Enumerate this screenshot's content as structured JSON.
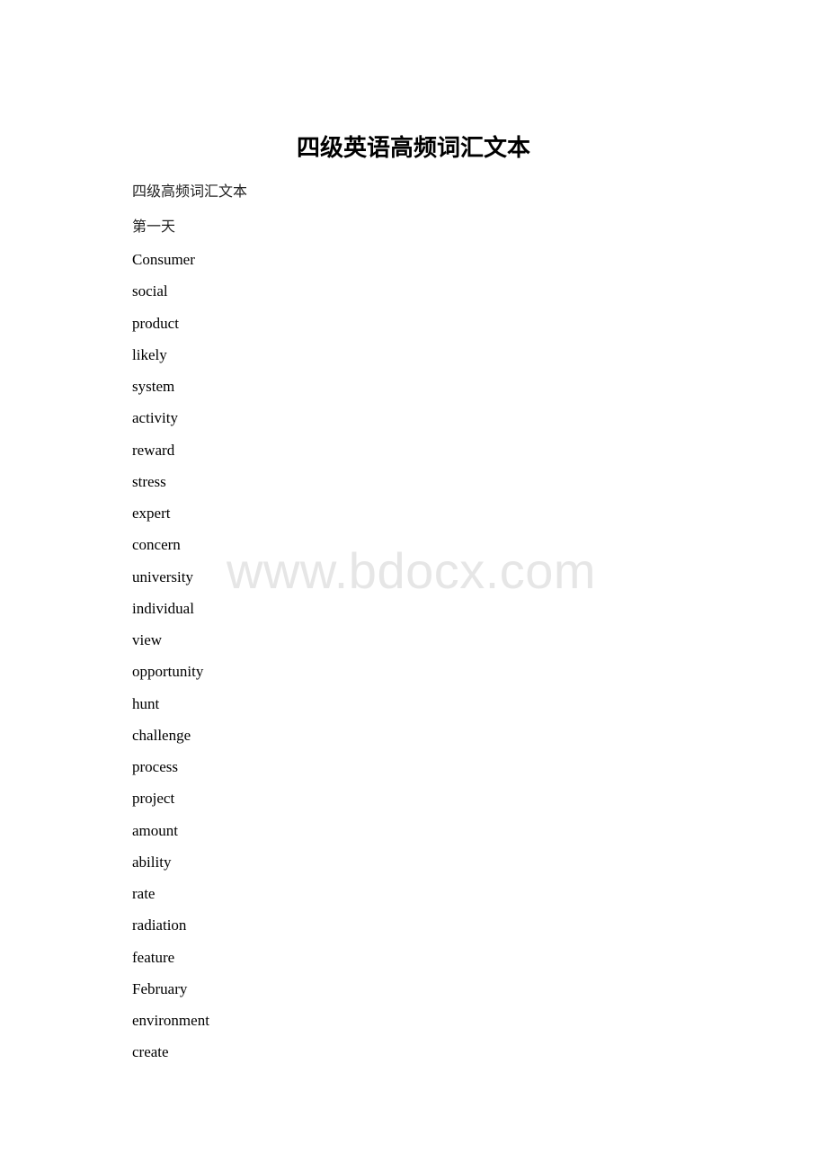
{
  "document": {
    "title": "四级英语高频词汇文本",
    "subtitle": "四级高频词汇文本",
    "day_heading": "第一天",
    "words": [
      "Consumer",
      "social",
      "product",
      "likely",
      "system",
      "activity",
      "reward",
      "stress",
      "expert",
      "concern",
      "university",
      "individual",
      "view",
      "opportunity",
      "hunt",
      "challenge",
      "process",
      "project",
      "amount",
      "ability",
      "rate",
      "radiation",
      "feature",
      "February",
      "environment",
      "create"
    ]
  },
  "watermark": {
    "text": "www.bdocx.com"
  }
}
